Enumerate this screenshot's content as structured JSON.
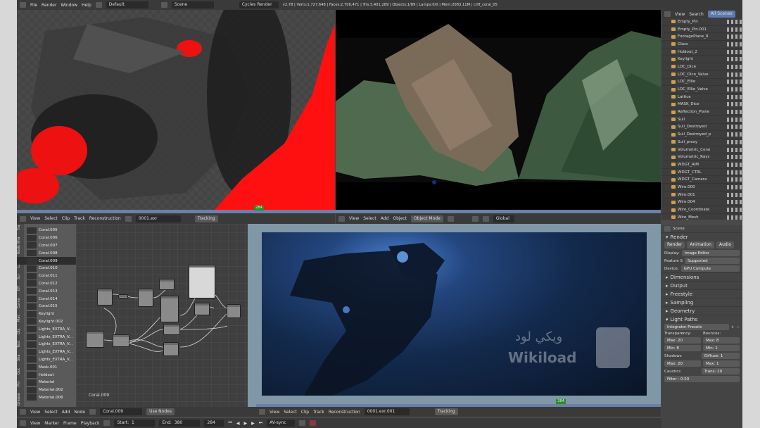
{
  "menubar": {
    "items": [
      "File",
      "Render",
      "Window",
      "Help"
    ],
    "layout": "Default",
    "scene": "Scene",
    "engine": "Cycles Render",
    "stats": "v2.78 | Verts:1,727,648 | Faces:2,700,471 | Tris:3,401,289 | Objects:1/89 | Lamps:0/0 | Mem:2083.11M | cliff_coral_05"
  },
  "frame_marker": "284",
  "outliner": {
    "tabs": [
      "View",
      "Search",
      "All Scenes"
    ],
    "items": [
      "Empty_Pin",
      "Empty_Pin.001",
      "FootagePlane_R",
      "Glass",
      "Holdout_2",
      "Keylight",
      "LOC_Dice",
      "LOC_Dice_Valve",
      "LOC_Ellie",
      "LOC_Ellie_Valve",
      "Lattice",
      "MASK_Dice",
      "Reflection_Plane",
      "Sull",
      "Sull_Destroyed",
      "Sull_Destroyed_p",
      "Sull_proxy",
      "Volumetric_Cone",
      "Volumetric_Rays",
      "WDGT_AIM",
      "WDGT_CTRL",
      "WDGT_Camera",
      "Wire.000",
      "Wire.001",
      "Wire.004",
      "Wire_Coordinate",
      "Wire_Mesh"
    ]
  },
  "clip_header": {
    "items": [
      "View",
      "Select",
      "Clip",
      "Track",
      "Reconstruction"
    ],
    "file": "0001.exr",
    "mode": "Tracking"
  },
  "view3d_header": {
    "items": [
      "View",
      "Select",
      "Add",
      "Object"
    ],
    "mode": "Object Mode",
    "orientation": "Global"
  },
  "clip_list": {
    "tabs": [
      "Grease",
      "Pin",
      "Out",
      "Sha",
      "Text",
      "Obj",
      "Mat",
      "Curve",
      "Eff",
      "Scr",
      "Lay",
      "Node Wra",
      "Tra"
    ],
    "items": [
      "Coral.005",
      "Coral.006",
      "Coral.007",
      "Coral.008",
      "Coral.009",
      "Coral.010",
      "Coral.011",
      "Coral.012",
      "Coral.013",
      "Coral.014",
      "Coral.015",
      "Keylight",
      "Keylight.002",
      "Lights_EXTRA_V...",
      "Lights_EXTRA_V...",
      "Lights_EXTRA_V...",
      "Lights_EXTRA_V...",
      "Lights_EXTRA_V...",
      "Mask.001",
      "Holdout",
      "Material",
      "Material.002",
      "Material.006"
    ],
    "selected_index": 4
  },
  "node_editor": {
    "label": "Coral.009",
    "footer_items": [
      "View",
      "Select",
      "Add",
      "Node"
    ],
    "material": "Coral.009",
    "use_nodes": "Use Nodes"
  },
  "clip_footer": {
    "items": [
      "View",
      "Select",
      "Clip",
      "Track",
      "Reconstruction"
    ],
    "file": "0001.exr.001",
    "mode": "Tracking"
  },
  "watermark": {
    "arabic": "ويكي لود",
    "latin": "Wikiload"
  },
  "properties": {
    "scene_label": "Scene",
    "render_heading": "Render",
    "tabs": [
      "Render",
      "Animation",
      "Audio"
    ],
    "fields": [
      {
        "label": "Display:",
        "value": "Image Editor"
      },
      {
        "label": "Feature S",
        "value": "Supported"
      },
      {
        "label": "Device:",
        "value": "GPU Compute"
      }
    ],
    "panels": [
      "Dimensions",
      "Output",
      "Freestyle",
      "Sampling",
      "Geometry",
      "Light Paths"
    ],
    "presets": "Integrator Presets",
    "transparency_label": "Transparency:",
    "bounces_label": "Bounces:",
    "max": "Max:",
    "max_val": "20",
    "min": "Min:",
    "min_val": "8",
    "shadows": "Shadows",
    "bmax_val": "8",
    "bmin_val": "1",
    "diffuse": "Diffuse:",
    "diffuse_val": "1",
    "glossy_val": "20",
    "caustics": "Caustics",
    "mmax": "Max:",
    "mmax_val": "1",
    "filter": "Filter : 0.50",
    "trans": "Trans:",
    "trans_val": "20"
  },
  "timeline": {
    "items": [
      "View",
      "Marker",
      "Frame",
      "Playback"
    ],
    "start": "Start:",
    "start_val": "1",
    "end": "End:",
    "end_val": "380",
    "current": "284",
    "sync": "AV-sync"
  }
}
